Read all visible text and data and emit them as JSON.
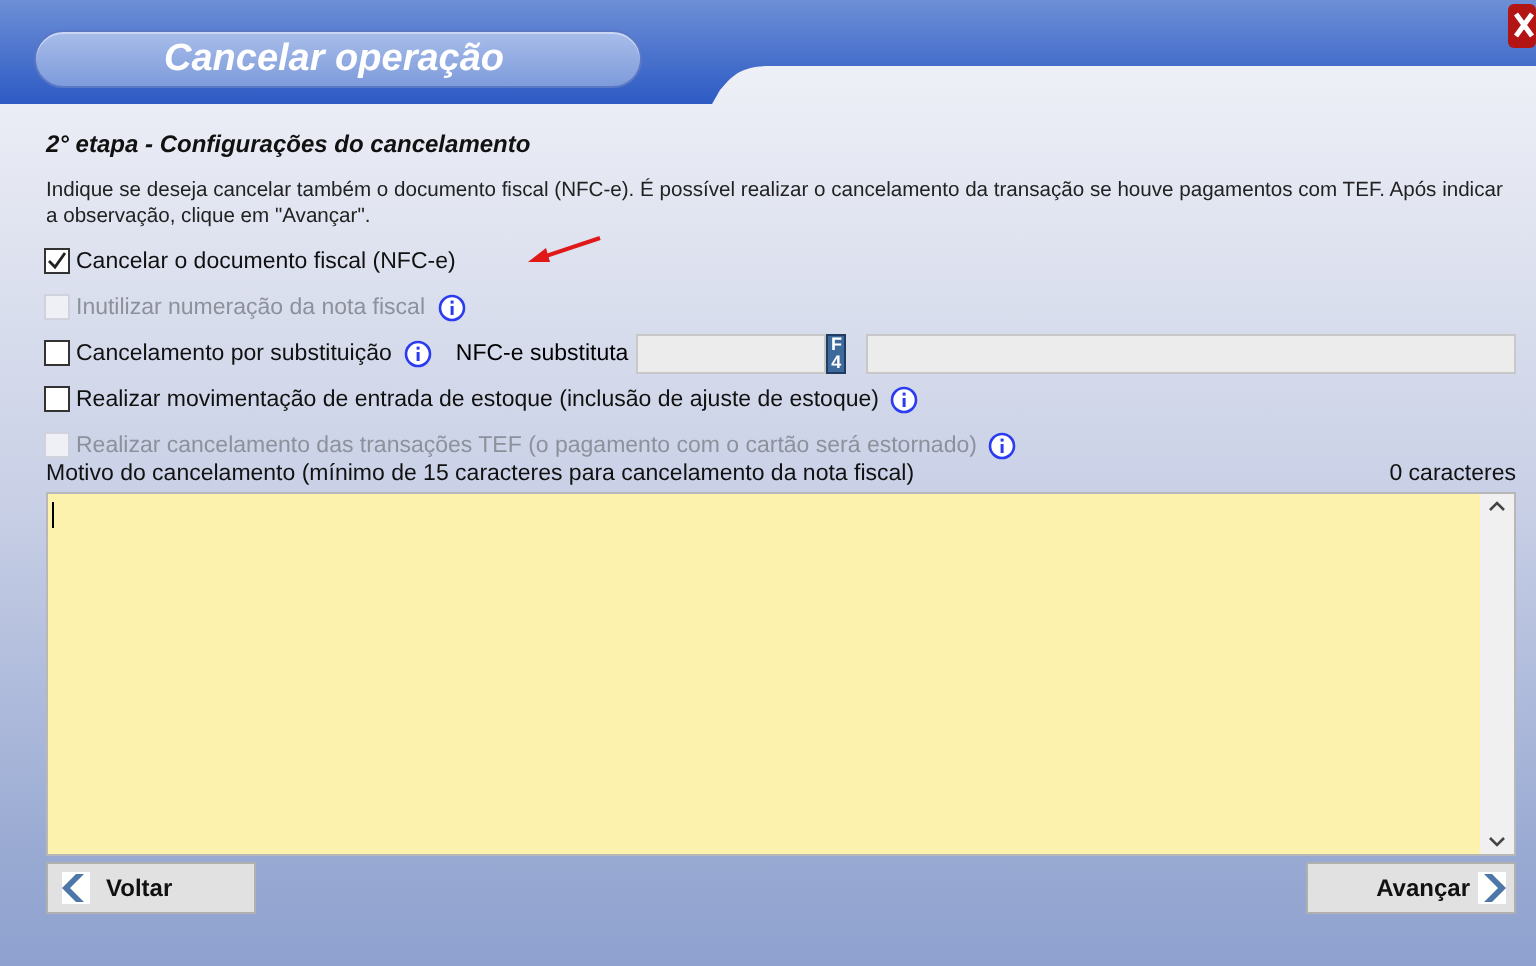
{
  "window": {
    "title": "Cancelar operação"
  },
  "step_title": "2° etapa - Configurações do cancelamento",
  "description": "Indique se deseja cancelar também o documento fiscal (NFC-e).  É possível realizar o cancelamento da transação se houve pagamentos com TEF.  Após indicar a observação, clique em \"Avançar\".",
  "options": [
    {
      "kind": "plain",
      "label": "Cancelar o documento fiscal (NFC-e)",
      "checked": true,
      "disabled": false,
      "info": false
    },
    {
      "kind": "plain",
      "label": "Inutilizar numeração da nota fiscal",
      "checked": false,
      "disabled": true,
      "info": true
    },
    {
      "kind": "substitution",
      "label": "Cancelamento por substituição",
      "checked": false,
      "disabled": false,
      "info": true,
      "field_label": "NFC-e substituta",
      "lookup_key": "F4"
    },
    {
      "kind": "plain",
      "label": "Realizar movimentação de entrada de estoque (inclusão de ajuste de estoque)",
      "checked": false,
      "disabled": false,
      "info": true
    },
    {
      "kind": "plain",
      "label": "Realizar cancelamento das transações TEF (o pagamento com o cartão será estornado)",
      "checked": false,
      "disabled": true,
      "info": true
    }
  ],
  "reason": {
    "label": "Motivo do cancelamento (mínimo de 15 caracteres para cancelamento da nota fiscal)",
    "counter": "0 caracteres"
  },
  "buttons": {
    "back": "Voltar",
    "next": "Avançar"
  }
}
